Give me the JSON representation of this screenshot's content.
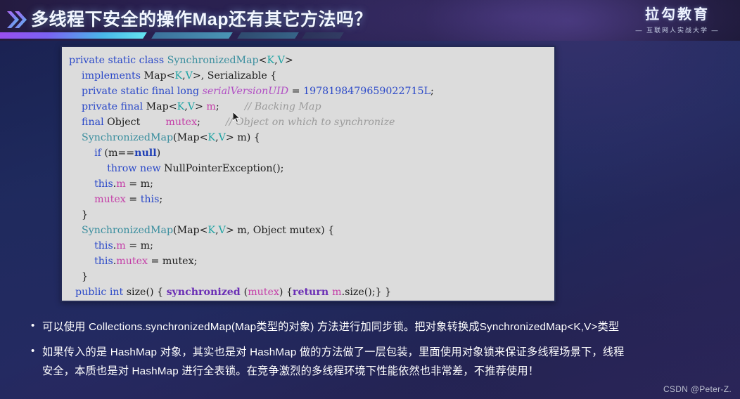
{
  "header": {
    "title": "多线程下安全的操作Map还有其它方法吗？",
    "chevron_icon": "double-chevron-right-icon",
    "logo_main": "拉勾教育",
    "logo_sub": "— 互联网人实战大学 —"
  },
  "code": {
    "language": "java",
    "lines": [
      [
        {
          "t": "private static class ",
          "c": "kw"
        },
        {
          "t": "SynchronizedMap",
          "c": "cls"
        },
        {
          "t": "<",
          "c": "pln"
        },
        {
          "t": "K",
          "c": "gen"
        },
        {
          "t": ",",
          "c": "pln"
        },
        {
          "t": "V",
          "c": "gen"
        },
        {
          "t": ">",
          "c": "pln"
        }
      ],
      [
        {
          "t": "    ",
          "c": "pln"
        },
        {
          "t": "implements ",
          "c": "kw"
        },
        {
          "t": "Map",
          "c": "pln"
        },
        {
          "t": "<",
          "c": "pln"
        },
        {
          "t": "K",
          "c": "gen"
        },
        {
          "t": ",",
          "c": "pln"
        },
        {
          "t": "V",
          "c": "gen"
        },
        {
          "t": ">, Serializable {",
          "c": "pln"
        }
      ],
      [
        {
          "t": "    ",
          "c": "pln"
        },
        {
          "t": "private static final long ",
          "c": "kw"
        },
        {
          "t": "serialVersionUID",
          "c": "ital"
        },
        {
          "t": " = ",
          "c": "pln"
        },
        {
          "t": "1978198479659022715L",
          "c": "num"
        },
        {
          "t": ";",
          "c": "pln"
        }
      ],
      [
        {
          "t": "    ",
          "c": "pln"
        },
        {
          "t": "private final ",
          "c": "kw"
        },
        {
          "t": "Map",
          "c": "pln"
        },
        {
          "t": "<",
          "c": "pln"
        },
        {
          "t": "K",
          "c": "gen"
        },
        {
          "t": ",",
          "c": "pln"
        },
        {
          "t": "V",
          "c": "gen"
        },
        {
          "t": "> ",
          "c": "pln"
        },
        {
          "t": "m",
          "c": "var"
        },
        {
          "t": ";",
          "c": "pln"
        },
        {
          "t": "        ",
          "c": "pln"
        },
        {
          "t": "// Backing Map",
          "c": "cmt"
        }
      ],
      [
        {
          "t": "    ",
          "c": "pln"
        },
        {
          "t": "final ",
          "c": "kw"
        },
        {
          "t": "Object        ",
          "c": "pln"
        },
        {
          "t": "mutex",
          "c": "var"
        },
        {
          "t": ";",
          "c": "pln"
        },
        {
          "t": "        ",
          "c": "pln"
        },
        {
          "t": "// Object on which to synchronize",
          "c": "cmt"
        }
      ],
      [
        {
          "t": "    ",
          "c": "pln"
        },
        {
          "t": "SynchronizedMap",
          "c": "cls"
        },
        {
          "t": "(Map",
          "c": "pln"
        },
        {
          "t": "<",
          "c": "pln"
        },
        {
          "t": "K",
          "c": "gen"
        },
        {
          "t": ",",
          "c": "pln"
        },
        {
          "t": "V",
          "c": "gen"
        },
        {
          "t": "> m) {",
          "c": "pln"
        }
      ],
      [
        {
          "t": "        ",
          "c": "pln"
        },
        {
          "t": "if ",
          "c": "kw"
        },
        {
          "t": "(m==",
          "c": "pln"
        },
        {
          "t": "null",
          "c": "kw2"
        },
        {
          "t": ")",
          "c": "pln"
        }
      ],
      [
        {
          "t": "            ",
          "c": "pln"
        },
        {
          "t": "throw new ",
          "c": "kw"
        },
        {
          "t": "NullPointerException();",
          "c": "pln"
        }
      ],
      [
        {
          "t": "        ",
          "c": "pln"
        },
        {
          "t": "this",
          "c": "kw"
        },
        {
          "t": ".",
          "c": "pln"
        },
        {
          "t": "m",
          "c": "var"
        },
        {
          "t": " = m;",
          "c": "pln"
        }
      ],
      [
        {
          "t": "        ",
          "c": "pln"
        },
        {
          "t": "mutex",
          "c": "var"
        },
        {
          "t": " = ",
          "c": "pln"
        },
        {
          "t": "this",
          "c": "kw"
        },
        {
          "t": ";",
          "c": "pln"
        }
      ],
      [
        {
          "t": "    }",
          "c": "pln"
        }
      ],
      [
        {
          "t": "    ",
          "c": "pln"
        },
        {
          "t": "SynchronizedMap",
          "c": "cls"
        },
        {
          "t": "(Map",
          "c": "pln"
        },
        {
          "t": "<",
          "c": "pln"
        },
        {
          "t": "K",
          "c": "gen"
        },
        {
          "t": ",",
          "c": "pln"
        },
        {
          "t": "V",
          "c": "gen"
        },
        {
          "t": "> m, Object mutex) {",
          "c": "pln"
        }
      ],
      [
        {
          "t": "        ",
          "c": "pln"
        },
        {
          "t": "this",
          "c": "kw"
        },
        {
          "t": ".",
          "c": "pln"
        },
        {
          "t": "m",
          "c": "var"
        },
        {
          "t": " = m;",
          "c": "pln"
        }
      ],
      [
        {
          "t": "        ",
          "c": "pln"
        },
        {
          "t": "this",
          "c": "kw"
        },
        {
          "t": ".",
          "c": "pln"
        },
        {
          "t": "mutex",
          "c": "var"
        },
        {
          "t": " = mutex;",
          "c": "pln"
        }
      ],
      [
        {
          "t": "    }",
          "c": "pln"
        }
      ],
      [
        {
          "t": "  ",
          "c": "pln"
        },
        {
          "t": "public int ",
          "c": "kw"
        },
        {
          "t": "size() { ",
          "c": "pln"
        },
        {
          "t": "synchronized ",
          "c": "pur"
        },
        {
          "t": "(",
          "c": "pln"
        },
        {
          "t": "mutex",
          "c": "var"
        },
        {
          "t": ") {",
          "c": "pln"
        },
        {
          "t": "return ",
          "c": "pur"
        },
        {
          "t": "m",
          "c": "var"
        },
        {
          "t": ".size();} }",
          "c": "pln"
        }
      ]
    ]
  },
  "bullets": [
    {
      "marker": "•",
      "lines": [
        "可以使用 Collections.synchronizedMap(Map类型的对象) 方法进行加同步锁。把对象转换成SynchronizedMap<K,V>类型"
      ]
    },
    {
      "marker": "•",
      "lines": [
        "如果传入的是 HashMap 对象，其实也是对 HashMap 做的方法做了一层包装，里面使用对象锁来保证多线程场景下，线程",
        "安全，本质也是对 HashMap 进行全表锁。在竞争激烈的多线程环境下性能依然也非常差，不推荐使用！"
      ]
    }
  ],
  "watermark": "CSDN @Peter-Z.",
  "colors": {
    "background_start": "#1b2050",
    "background_end": "#2a2456",
    "header_bg": "#2a2050",
    "code_bg": "#dcdcdc",
    "code_border": "#232a55",
    "text": "#ffffff",
    "accent_purple": "#9b4df0",
    "accent_cyan": "#63e2f0"
  }
}
